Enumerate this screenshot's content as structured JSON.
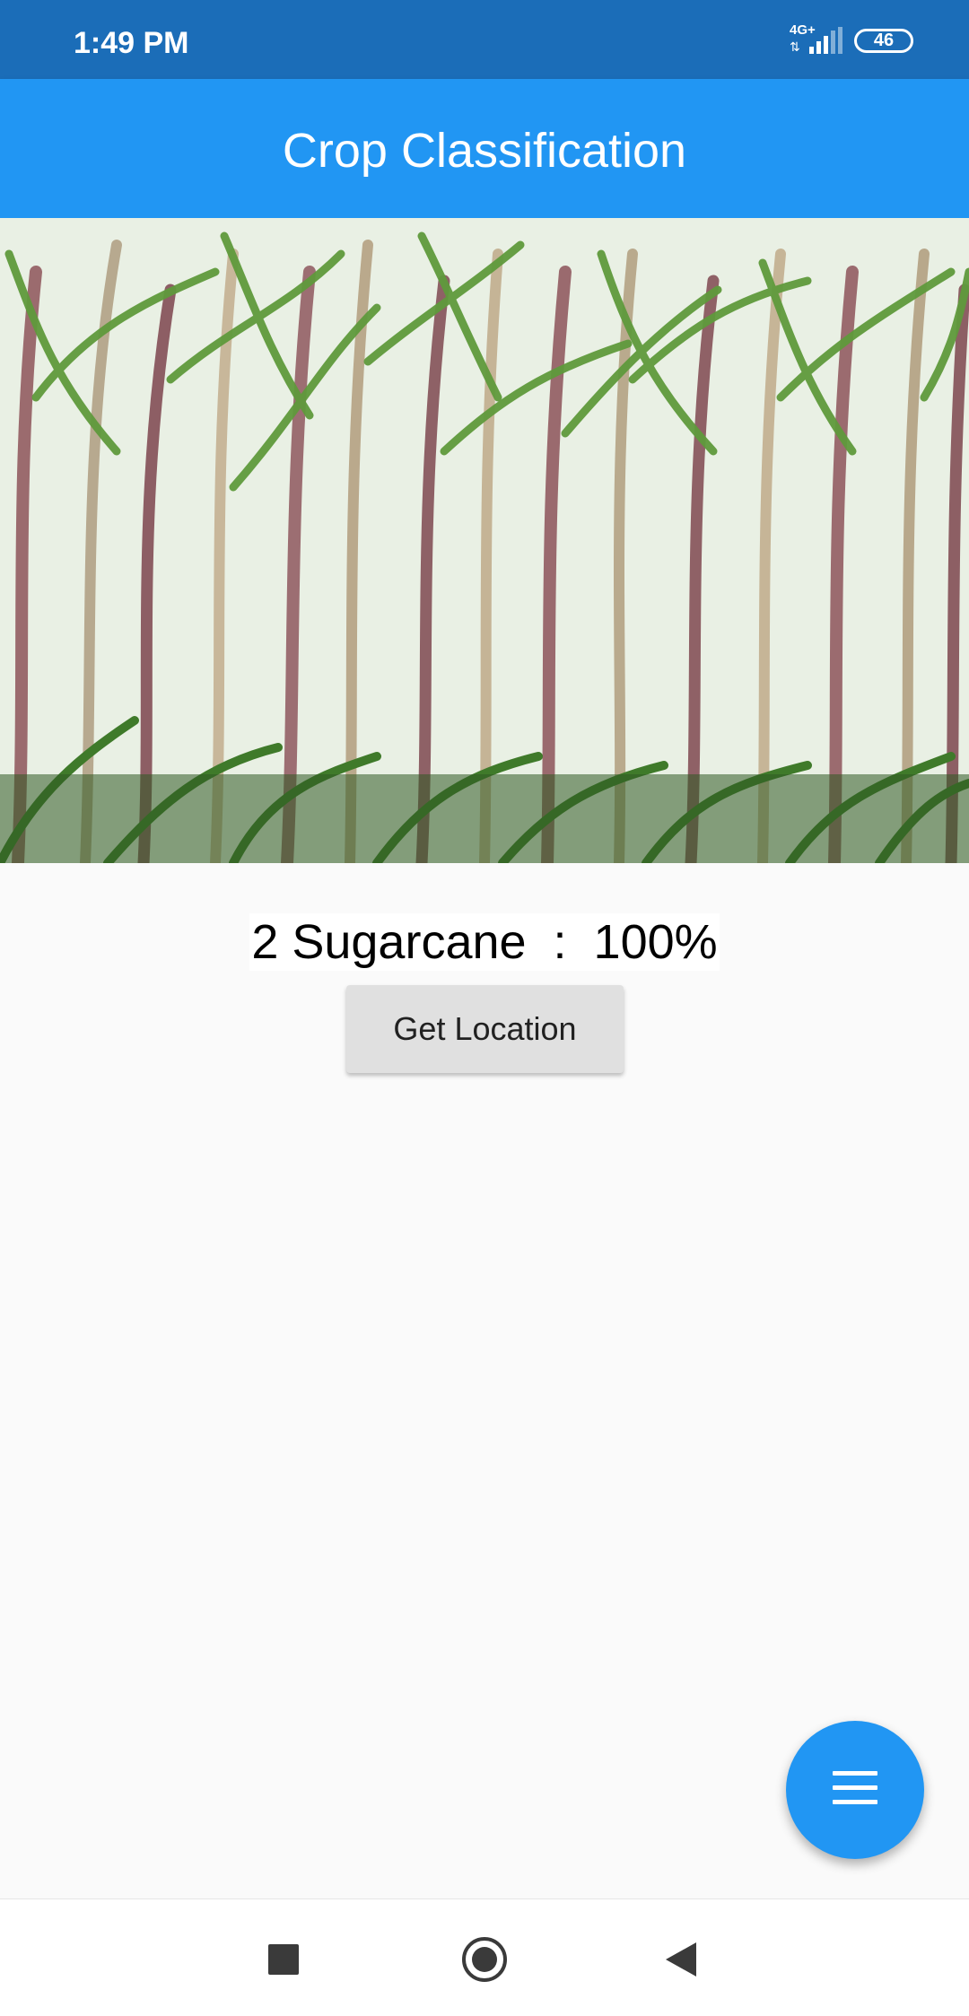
{
  "status_bar": {
    "time": "1:49 PM",
    "network": "4G+",
    "battery": "46",
    "icons": [
      "signal-icon",
      "battery-icon"
    ]
  },
  "app_bar": {
    "title": "Crop Classification"
  },
  "main": {
    "image_subject": "sugarcane crop photo",
    "result_text": "2 Sugarcane  :  100%",
    "get_location_label": "Get Location"
  },
  "fab": {
    "icon": "menu-icon"
  },
  "nav_bar": {
    "icons": [
      "recents-icon",
      "home-icon",
      "back-icon"
    ]
  },
  "colors": {
    "status_bar": "#1b6db8",
    "app_bar": "#2196f3",
    "fab": "#2196f3",
    "button": "#e0e0e0",
    "background": "#fafafa"
  }
}
